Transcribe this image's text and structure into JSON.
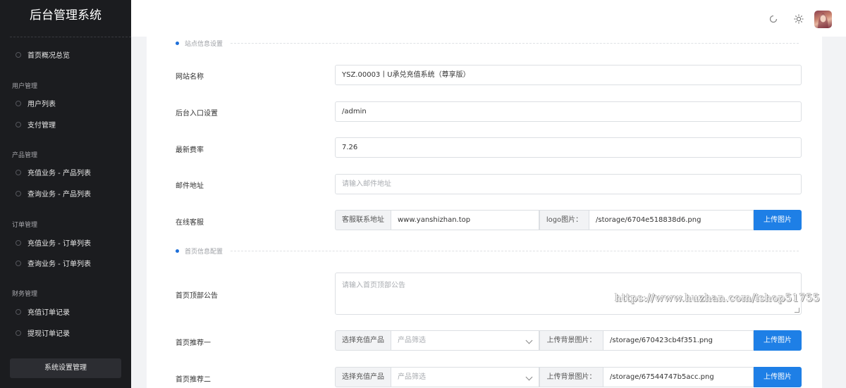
{
  "app": {
    "title": "后台管理系统"
  },
  "sidebar": {
    "home": "首页概况总览",
    "groups": [
      {
        "title": "用户管理",
        "items": [
          "用户列表",
          "支付管理"
        ]
      },
      {
        "title": "产品管理",
        "items": [
          "充值业务 - 产品列表",
          "查询业务 - 产品列表"
        ]
      },
      {
        "title": "订单管理",
        "items": [
          "充值业务 - 订单列表",
          "查询业务 - 订单列表"
        ]
      },
      {
        "title": "财务管理",
        "items": [
          "充值订单记录",
          "提现订单记录"
        ]
      }
    ],
    "bottom": "系统设置管理"
  },
  "topbar": {
    "icons": [
      "refresh-icon",
      "sun-icon",
      "avatar"
    ]
  },
  "sections": {
    "site": "站点信息设置",
    "home": "首页信息配置"
  },
  "form": {
    "site_name": {
      "label": "网站名称",
      "value": "YSZ.00003丨U承兑充值系统（尊享版）"
    },
    "admin_entry": {
      "label": "后台入口设置",
      "value": "/admin"
    },
    "rate": {
      "label": "最新费率",
      "value": "7.26"
    },
    "email": {
      "label": "邮件地址",
      "placeholder": "请输入邮件地址"
    },
    "service": {
      "label": "在线客服",
      "contact_label": "客服联系地址",
      "contact_value": "www.yanshizhan.top",
      "logo_label": "logo图片：",
      "logo_value": "/storage/6704e518838d6.png",
      "upload": "上传图片"
    },
    "notice": {
      "label": "首页顶部公告",
      "placeholder": "请输入首页顶部公告"
    },
    "rec1": {
      "label": "首页推荐一",
      "select_label": "选择充值产品",
      "select_placeholder": "产品筛选",
      "bg_label": "上传背景图片：",
      "bg_value": "/storage/670423cb4f351.png",
      "upload": "上传图片"
    },
    "rec2": {
      "label": "首页推荐二",
      "select_label": "选择充值产品",
      "select_placeholder": "产品筛选",
      "bg_label": "上传背景图片：",
      "bg_value": "/storage/67544747b5acc.png",
      "upload": "上传图片"
    }
  },
  "watermark": "https://www.huzhan.com/ishop51755",
  "colors": {
    "sidebar_bg": "#1b1c1f",
    "primary": "#1e7fe6",
    "bullet": "#1e6fd9"
  }
}
